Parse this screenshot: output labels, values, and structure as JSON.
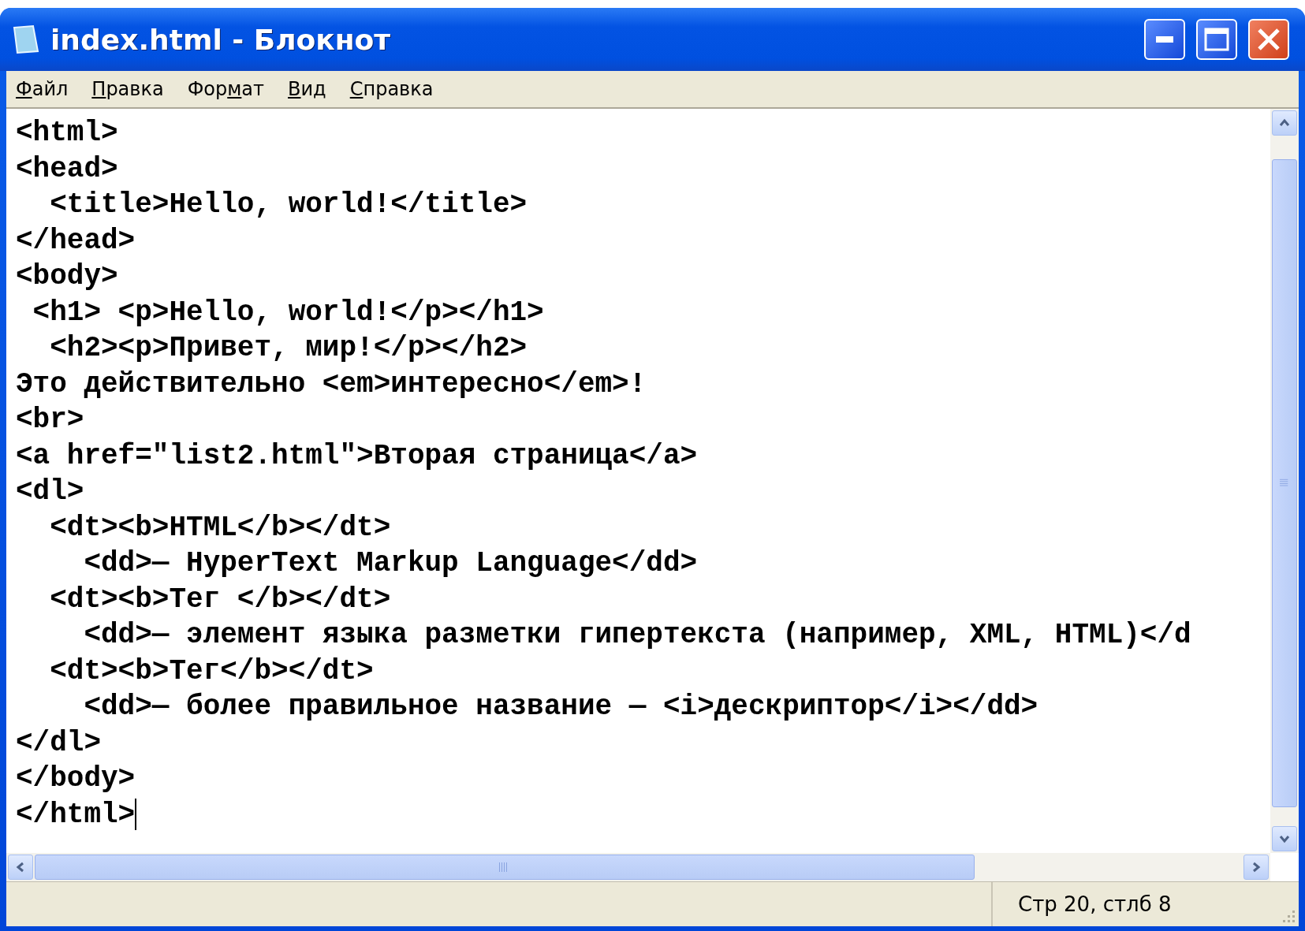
{
  "window": {
    "title": "index.html - Блокнот"
  },
  "menu": [
    {
      "key": "Ф",
      "after": "айл"
    },
    {
      "key": "П",
      "after": "равка"
    },
    {
      "before": "Фор",
      "key": "м",
      "after": "ат"
    },
    {
      "key": "В",
      "after": "ид"
    },
    {
      "key": "С",
      "after": "правка"
    }
  ],
  "editor": {
    "lines": [
      "<html>",
      "<head>",
      "  <title>Hello, world!</title>",
      "</head>",
      "<body>",
      " <h1> <p>Hello, world!</p></h1>",
      "  <h2><p>Привет, мир!</p></h2>",
      "Это действительно <em>интересно</em>!",
      "<br>",
      "<a href=\"list2.html\">Вторая страница</a>",
      "<dl>",
      "  <dt><b>HTML</b></dt>",
      "    <dd>— HyperText Markup Language</dd>",
      "  <dt><b>Тег </b></dt>",
      "    <dd>— элемент языка разметки гипертекста (например, XML, HTML)</d",
      "  <dt><b>Тег</b></dt>",
      "    <dd>— более правильное название — <i>дескриптор</i></dd>",
      "</dl>",
      "</body>",
      "</html>"
    ]
  },
  "status_bar": {
    "position": "Стр 20, стлб 8"
  }
}
